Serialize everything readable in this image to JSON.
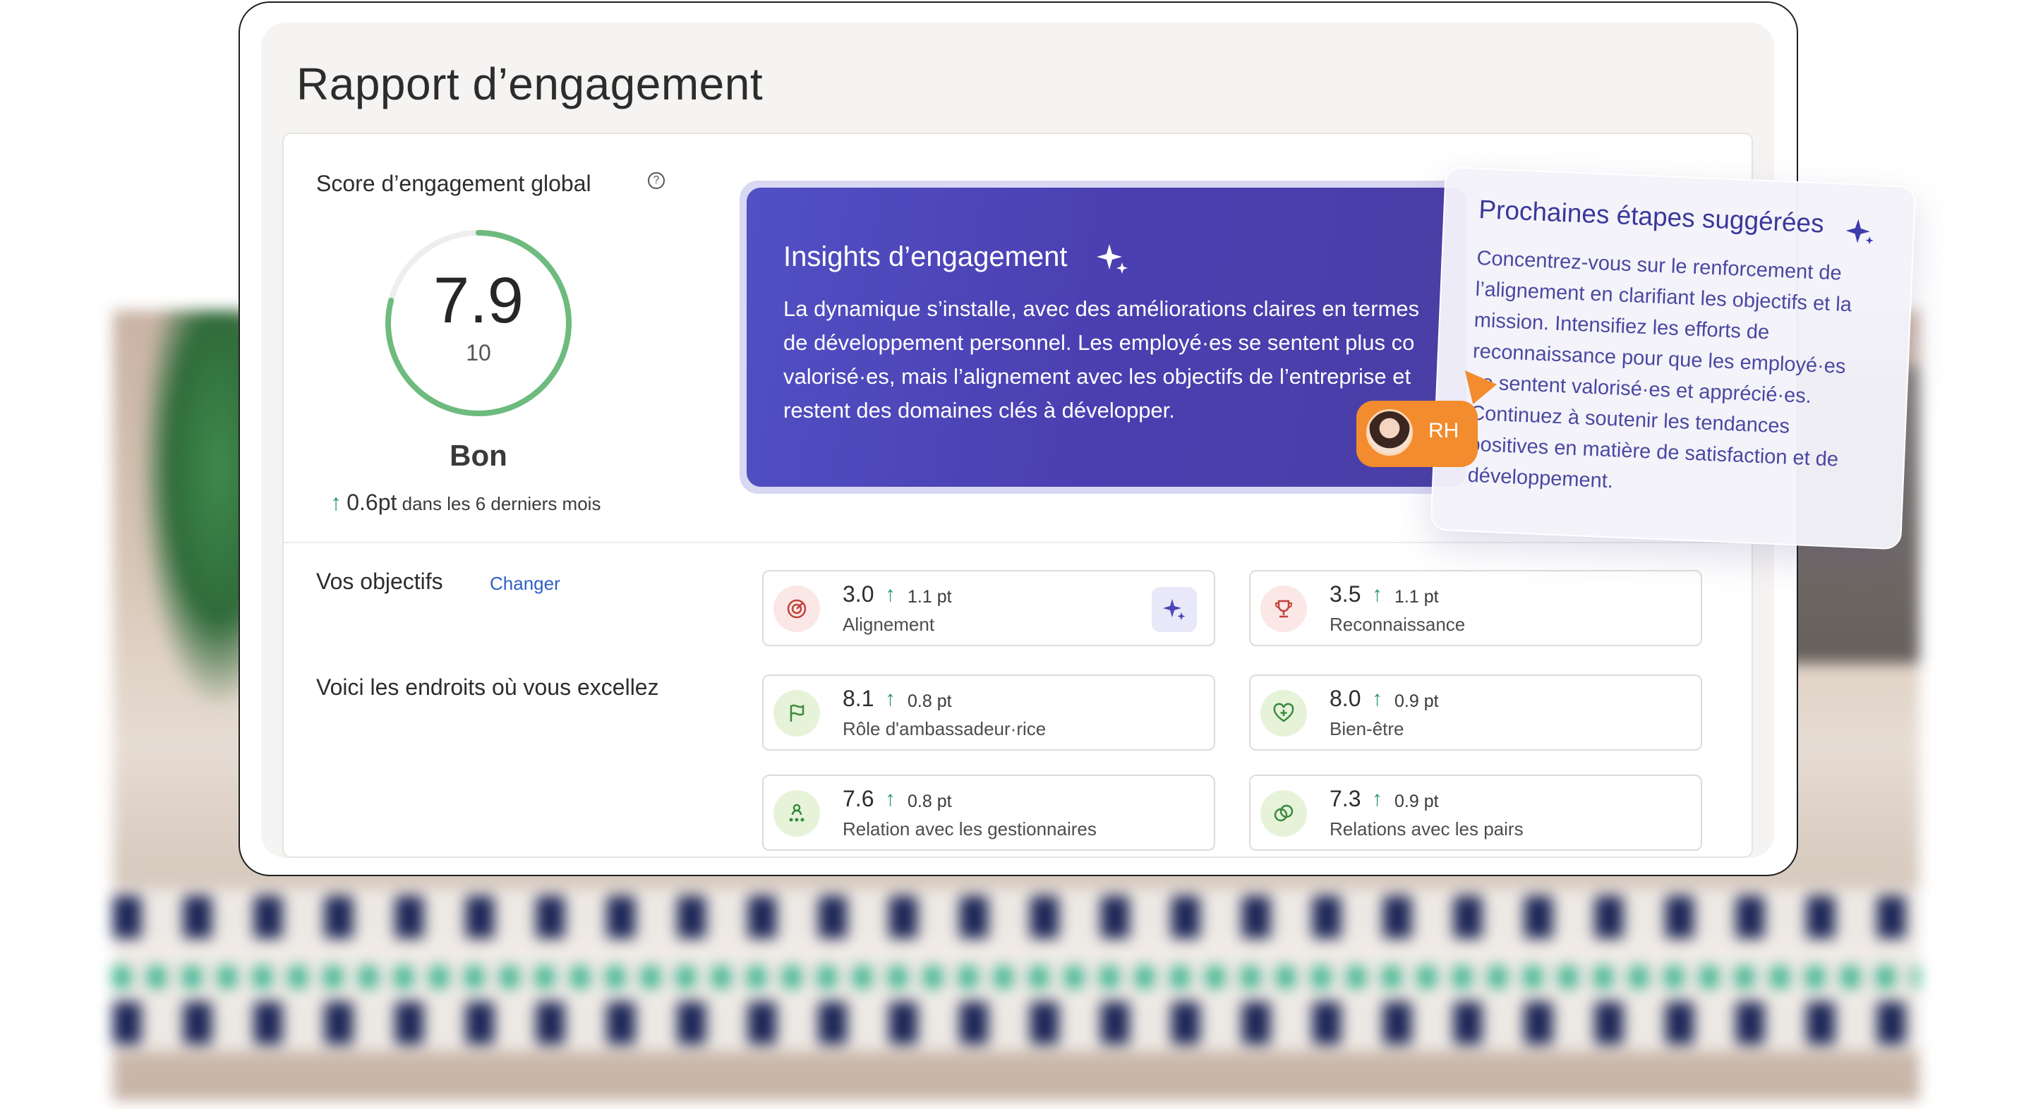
{
  "page": {
    "title": "Rapport d’engagement"
  },
  "score": {
    "title": "Score d’engagement global",
    "value": "7.9",
    "max": "10",
    "fraction": 0.79,
    "rating": "Bon",
    "delta": "0.6pt",
    "delta_period": "dans les 6 derniers mois",
    "gauge_color": "#6dbb7e"
  },
  "insights": {
    "title": "Insights d’engagement",
    "lines": [
      "La dynamique s’installe, avec des améliorations claires en termes",
      "de développement personnel. Les employé·es se sentent plus co",
      "valorisé·es, mais l’alignement avec les objectifs de l’entreprise et",
      "restent des domaines clés à développer."
    ],
    "bg_color": "#4a3fb0"
  },
  "hr_badge": {
    "label": "RH",
    "color": "#f28c2e"
  },
  "suggestions": {
    "title": "Prochaines étapes suggérées",
    "lines": [
      "Concentrez-vous sur le renforcement de",
      "l’alignement en clarifiant les objectifs et la",
      "mission. Intensifiez les efforts de",
      "reconnaissance pour que les employé·es",
      "se sentent valorisé·es et apprécié·es.",
      "Continuez à soutenir les tendances",
      "positives en matière de satisfaction et de",
      "développement."
    ]
  },
  "objectives": {
    "title": "Vos objectifs",
    "change_label": "Changer",
    "items": [
      {
        "value": "3.0",
        "delta": "1.1 pt",
        "label": "Alignement",
        "icon": "target-icon"
      },
      {
        "value": "3.5",
        "delta": "1.1 pt",
        "label": "Reconnaissance",
        "icon": "trophy-icon"
      }
    ]
  },
  "excel": {
    "title": "Voici les endroits où vous excellez",
    "items": [
      {
        "value": "8.1",
        "delta": "0.8 pt",
        "label": "Rôle d'ambassadeur·rice",
        "icon": "flag-icon"
      },
      {
        "value": "8.0",
        "delta": "0.9 pt",
        "label": "Bien-être",
        "icon": "heart-plus-icon"
      },
      {
        "value": "7.6",
        "delta": "0.8 pt",
        "label": "Relation avec les gestionnaires",
        "icon": "hierarchy-icon"
      },
      {
        "value": "7.3",
        "delta": "0.9 pt",
        "label": "Relations avec les pairs",
        "icon": "peers-icon"
      }
    ]
  }
}
